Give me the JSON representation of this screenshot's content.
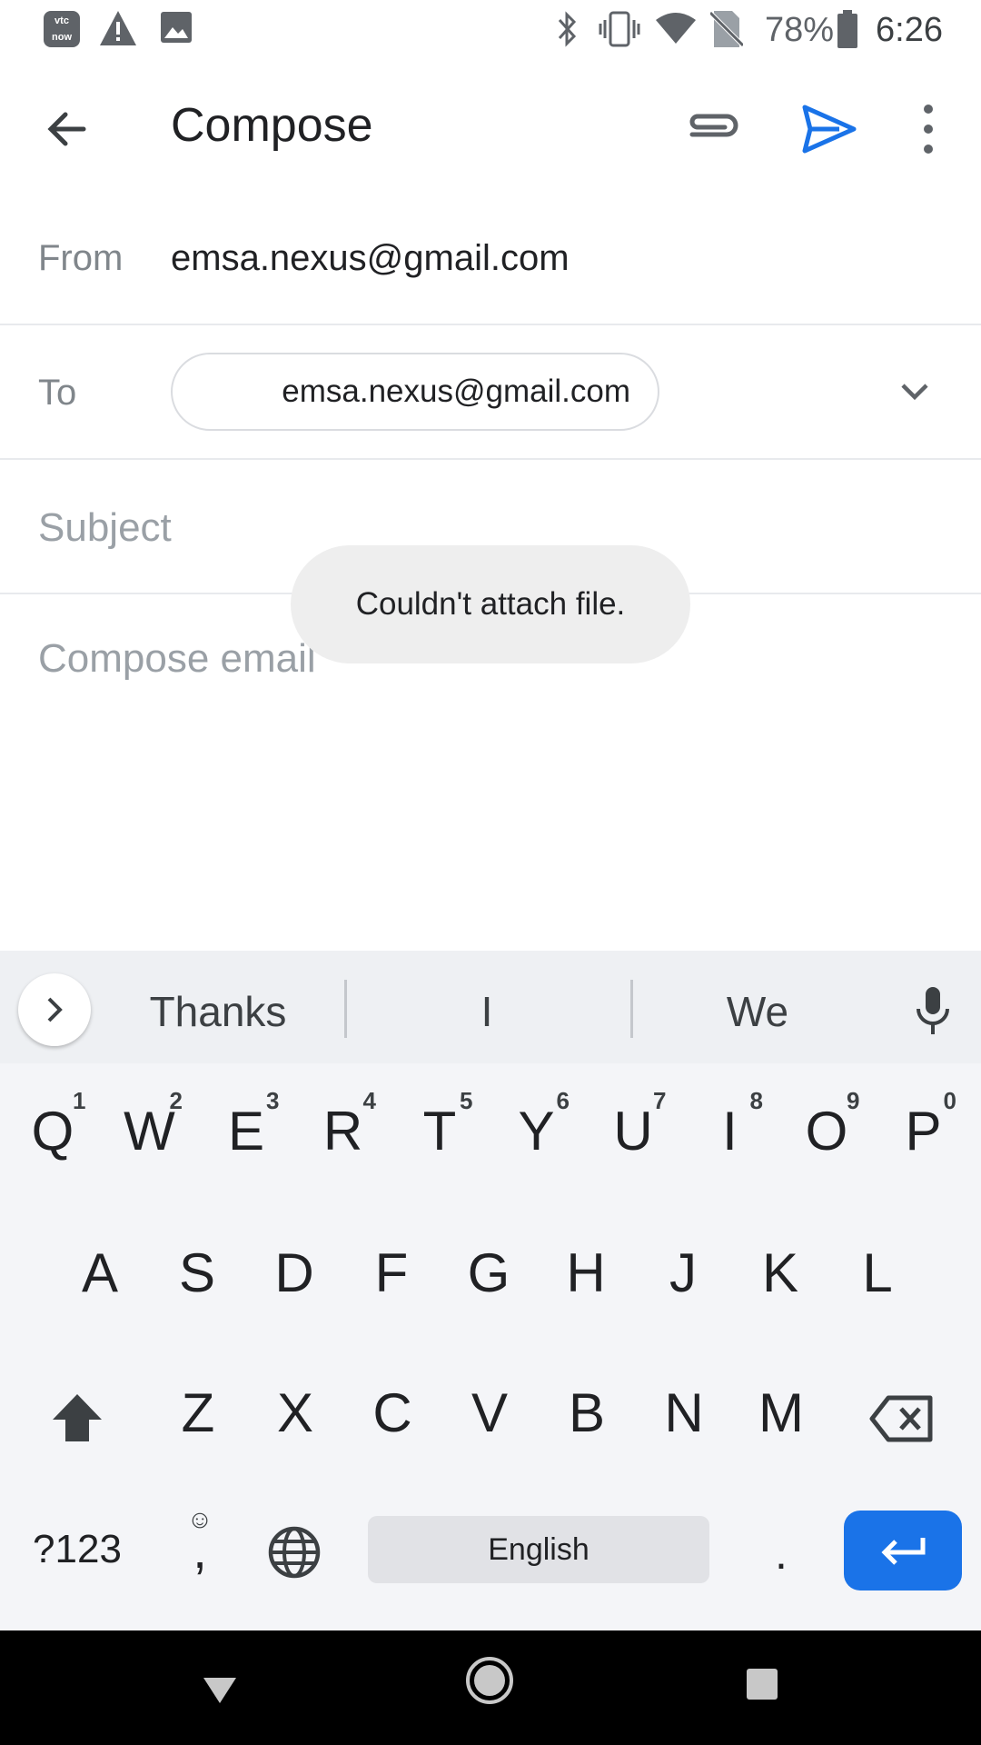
{
  "status_bar": {
    "battery": "78%",
    "time": "6:26",
    "app_badge": "vtc now"
  },
  "app_bar": {
    "title": "Compose"
  },
  "from": {
    "label": "From",
    "value": "emsa.nexus@gmail.com"
  },
  "to": {
    "label": "To",
    "chip": "emsa.nexus@gmail.com"
  },
  "subject": {
    "placeholder": "Subject"
  },
  "body": {
    "placeholder": "Compose email"
  },
  "toast": {
    "text": "Couldn't attach file."
  },
  "keyboard": {
    "suggestions": [
      "Thanks",
      "I",
      "We"
    ],
    "row1": [
      "Q",
      "W",
      "E",
      "R",
      "T",
      "Y",
      "U",
      "I",
      "O",
      "P"
    ],
    "row1_numbers": [
      "1",
      "2",
      "3",
      "4",
      "5",
      "6",
      "7",
      "8",
      "9",
      "0"
    ],
    "row2": [
      "A",
      "S",
      "D",
      "F",
      "G",
      "H",
      "J",
      "K",
      "L"
    ],
    "row3": [
      "Z",
      "X",
      "C",
      "V",
      "B",
      "N",
      "M"
    ],
    "symbols_key": "?123",
    "comma_key": ",",
    "emoji_key": "☺",
    "space_label": "English",
    "period_key": "."
  },
  "colors": {
    "accent": "#1a73e8",
    "keyboard_bg": "#f4f5f8"
  }
}
